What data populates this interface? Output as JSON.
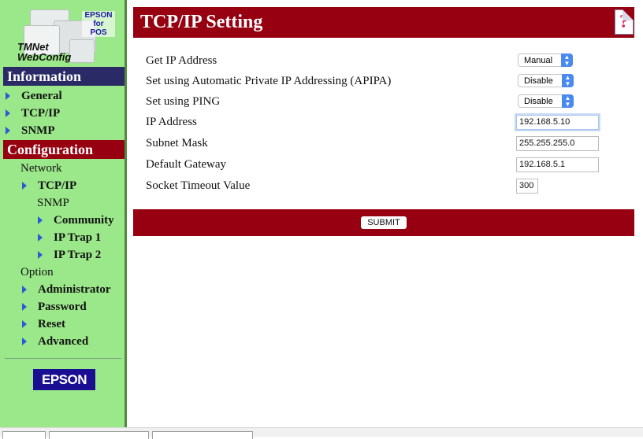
{
  "logo": {
    "brand_label": "EPSON for POS",
    "brand_lines": [
      "EPSON",
      "for",
      "POS"
    ],
    "product_lines": [
      "TMNet",
      "WebConfig"
    ]
  },
  "sidebar": {
    "information": {
      "header": "Information",
      "items": [
        {
          "label": "General",
          "icon": "triangle-right-icon"
        },
        {
          "label": "TCP/IP",
          "icon": "triangle-right-icon"
        },
        {
          "label": "SNMP",
          "icon": "triangle-right-icon"
        }
      ]
    },
    "configuration": {
      "header": "Configuration",
      "network": {
        "label": "Network",
        "tcpip": {
          "label": "TCP/IP",
          "icon": "triangle-right-icon"
        },
        "snmp": {
          "label": "SNMP",
          "items": [
            {
              "label": "Community",
              "icon": "triangle-right-icon"
            },
            {
              "label": "IP Trap 1",
              "icon": "triangle-right-icon"
            },
            {
              "label": "IP Trap 2",
              "icon": "triangle-right-icon"
            }
          ]
        }
      },
      "option": {
        "label": "Option",
        "items": [
          {
            "label": "Administrator",
            "icon": "triangle-right-icon"
          },
          {
            "label": "Password",
            "icon": "triangle-right-icon"
          },
          {
            "label": "Reset",
            "icon": "triangle-right-icon"
          },
          {
            "label": "Advanced",
            "icon": "triangle-right-icon"
          }
        ]
      }
    },
    "footer_logo": "EPSON"
  },
  "main": {
    "title": "TCP/IP Setting",
    "help_icon": "?",
    "fields": [
      {
        "label": "Get IP Address",
        "type": "select",
        "value": "Manual"
      },
      {
        "label": "Set using Automatic Private IP Addressing (APIPA)",
        "type": "select",
        "value": "Disable"
      },
      {
        "label": "Set using PING",
        "type": "select",
        "value": "Disable"
      },
      {
        "label": "IP Address",
        "type": "text",
        "value": "192.168.5.10"
      },
      {
        "label": "Subnet Mask",
        "type": "text",
        "value": "255.255.255.0"
      },
      {
        "label": "Default Gateway",
        "type": "text",
        "value": "192.168.5.1"
      },
      {
        "label": "Socket Timeout Value",
        "type": "text",
        "value": "300"
      }
    ],
    "submit_label": "SUBMIT"
  },
  "colors": {
    "sidebar_bg": "#9be88a",
    "info_header_bg": "#2a2a66",
    "config_header_bg": "#960010",
    "title_bar_bg": "#960010",
    "arrow": "#2a5ad8",
    "epson_logo_bg": "#1a0e92",
    "select_button": "#4a8af0"
  }
}
